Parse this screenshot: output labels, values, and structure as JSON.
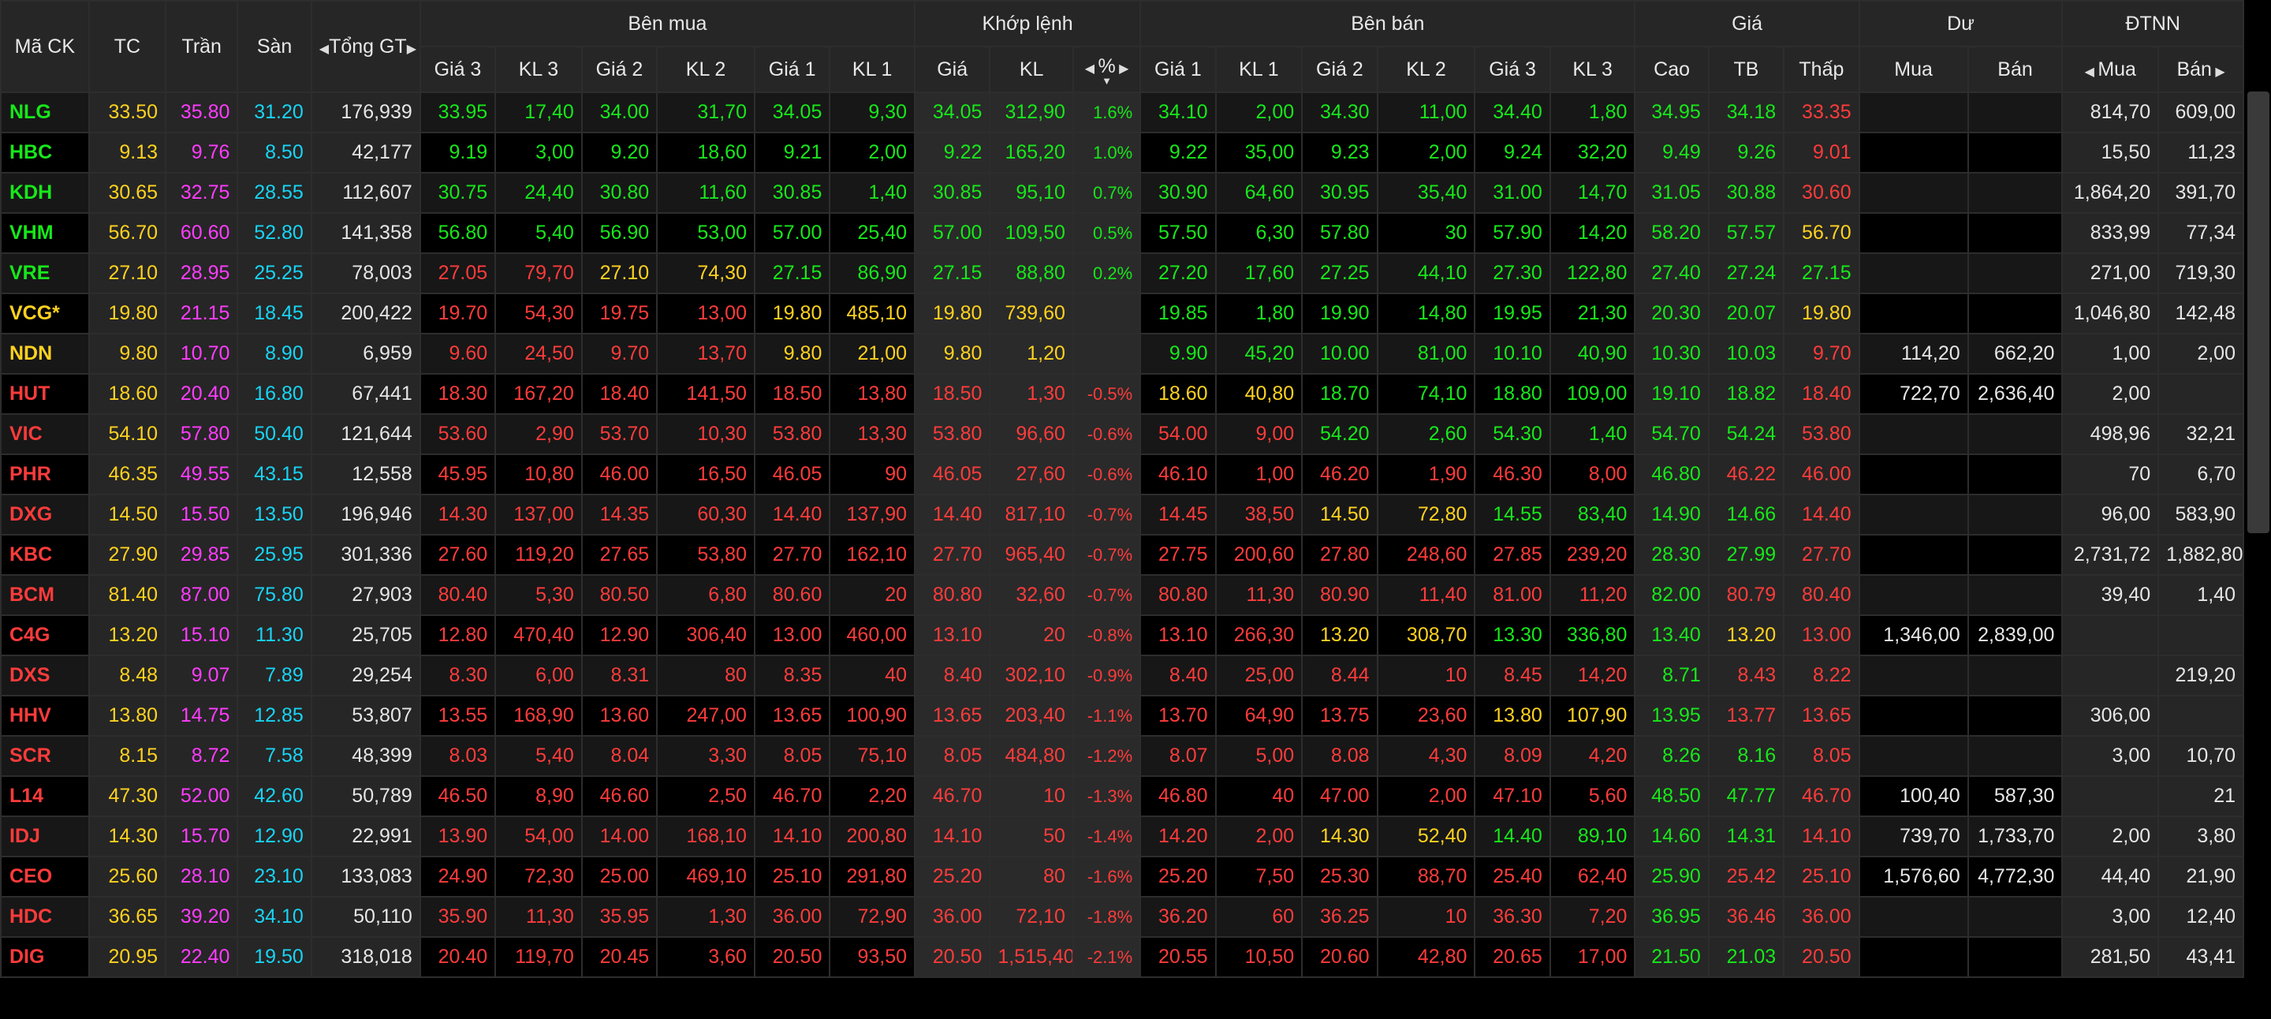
{
  "header": {
    "ma_ck": "Mã CK",
    "tc": "TC",
    "tran": "Trần",
    "san": "Sàn",
    "tong_gt": "Tổng GT",
    "ben_mua": "Bên mua",
    "khop_lenh": "Khớp lệnh",
    "ben_ban": "Bên bán",
    "gia": "Giá",
    "du": "Dư",
    "dtnn": "ĐTNN",
    "sub": {
      "gia3": "Giá 3",
      "kl3": "KL 3",
      "gia2": "Giá 2",
      "kl2": "KL 2",
      "gia1": "Giá 1",
      "kl1": "KL 1",
      "khop_gia": "Giá",
      "khop_kl": "KL",
      "pct": "%",
      "cao": "Cao",
      "tb": "TB",
      "thap": "Thấp",
      "du_mua": "Mua",
      "du_ban": "Bán",
      "dtnn_mua": "Mua",
      "dtnn_ban": "Bán"
    }
  },
  "colors": {
    "up": "#17e81a",
    "down": "#ff3b3b",
    "ref": "#ffd21f",
    "ceiling": "#ff3cff",
    "floor": "#18d4f4"
  },
  "rows": [
    {
      "sym": "NLG",
      "sc": "g",
      "tc": "33.50",
      "tran": "35.80",
      "san": "31.20",
      "tong": "176,939",
      "b3": [
        "33.95",
        "17,40",
        "g"
      ],
      "b2": [
        "34.00",
        "31,70",
        "g"
      ],
      "b1": [
        "34.05",
        "9,30",
        "g"
      ],
      "m": [
        "34.05",
        "312,90",
        "1.6%",
        "g"
      ],
      "s1": [
        "34.10",
        "2,00",
        "g"
      ],
      "s2": [
        "34.30",
        "11,00",
        "g"
      ],
      "s3": [
        "34.40",
        "1,80",
        "g"
      ],
      "cao": [
        "34.95",
        "g"
      ],
      "tb": [
        "34.18",
        "g"
      ],
      "thap": [
        "33.35",
        "r"
      ],
      "dm": "",
      "db": "",
      "nm": "814,70",
      "nb": "609,00"
    },
    {
      "sym": "HBC",
      "sc": "g",
      "tc": "9.13",
      "tran": "9.76",
      "san": "8.50",
      "tong": "42,177",
      "b3": [
        "9.19",
        "3,00",
        "g"
      ],
      "b2": [
        "9.20",
        "18,60",
        "g"
      ],
      "b1": [
        "9.21",
        "2,00",
        "g"
      ],
      "m": [
        "9.22",
        "165,20",
        "1.0%",
        "g"
      ],
      "s1": [
        "9.22",
        "35,00",
        "g"
      ],
      "s2": [
        "9.23",
        "2,00",
        "g"
      ],
      "s3": [
        "9.24",
        "32,20",
        "g"
      ],
      "cao": [
        "9.49",
        "g"
      ],
      "tb": [
        "9.26",
        "g"
      ],
      "thap": [
        "9.01",
        "r"
      ],
      "dm": "",
      "db": "",
      "nm": "15,50",
      "nb": "11,23"
    },
    {
      "sym": "KDH",
      "sc": "g",
      "tc": "30.65",
      "tran": "32.75",
      "san": "28.55",
      "tong": "112,607",
      "b3": [
        "30.75",
        "24,40",
        "g"
      ],
      "b2": [
        "30.80",
        "11,60",
        "g"
      ],
      "b1": [
        "30.85",
        "1,40",
        "g"
      ],
      "m": [
        "30.85",
        "95,10",
        "0.7%",
        "g"
      ],
      "s1": [
        "30.90",
        "64,60",
        "g"
      ],
      "s2": [
        "30.95",
        "35,40",
        "g"
      ],
      "s3": [
        "31.00",
        "14,70",
        "g"
      ],
      "cao": [
        "31.05",
        "g"
      ],
      "tb": [
        "30.88",
        "g"
      ],
      "thap": [
        "30.60",
        "r"
      ],
      "dm": "",
      "db": "",
      "nm": "1,864,20",
      "nb": "391,70"
    },
    {
      "sym": "VHM",
      "sc": "g",
      "tc": "56.70",
      "tran": "60.60",
      "san": "52.80",
      "tong": "141,358",
      "b3": [
        "56.80",
        "5,40",
        "g"
      ],
      "b2": [
        "56.90",
        "53,00",
        "g"
      ],
      "b1": [
        "57.00",
        "25,40",
        "g"
      ],
      "m": [
        "57.00",
        "109,50",
        "0.5%",
        "g"
      ],
      "s1": [
        "57.50",
        "6,30",
        "g"
      ],
      "s2": [
        "57.80",
        "30",
        "g"
      ],
      "s3": [
        "57.90",
        "14,20",
        "g"
      ],
      "cao": [
        "58.20",
        "g"
      ],
      "tb": [
        "57.57",
        "g"
      ],
      "thap": [
        "56.70",
        "y"
      ],
      "dm": "",
      "db": "",
      "nm": "833,99",
      "nb": "77,34"
    },
    {
      "sym": "VRE",
      "sc": "g",
      "tc": "27.10",
      "tran": "28.95",
      "san": "25.25",
      "tong": "78,003",
      "b3": [
        "27.05",
        "79,70",
        "r"
      ],
      "b2": [
        "27.10",
        "74,30",
        "y"
      ],
      "b1": [
        "27.15",
        "86,90",
        "g"
      ],
      "m": [
        "27.15",
        "88,80",
        "0.2%",
        "g"
      ],
      "s1": [
        "27.20",
        "17,60",
        "g"
      ],
      "s2": [
        "27.25",
        "44,10",
        "g"
      ],
      "s3": [
        "27.30",
        "122,80",
        "g"
      ],
      "cao": [
        "27.40",
        "g"
      ],
      "tb": [
        "27.24",
        "g"
      ],
      "thap": [
        "27.15",
        "g"
      ],
      "dm": "",
      "db": "",
      "nm": "271,00",
      "nb": "719,30"
    },
    {
      "sym": "VCG*",
      "sc": "y",
      "tc": "19.80",
      "tran": "21.15",
      "san": "18.45",
      "tong": "200,422",
      "b3": [
        "19.70",
        "54,30",
        "r"
      ],
      "b2": [
        "19.75",
        "13,00",
        "r"
      ],
      "b1": [
        "19.80",
        "485,10",
        "y"
      ],
      "m": [
        "19.80",
        "739,60",
        "",
        "y"
      ],
      "s1": [
        "19.85",
        "1,80",
        "g"
      ],
      "s2": [
        "19.90",
        "14,80",
        "g"
      ],
      "s3": [
        "19.95",
        "21,30",
        "g"
      ],
      "cao": [
        "20.30",
        "g"
      ],
      "tb": [
        "20.07",
        "g"
      ],
      "thap": [
        "19.80",
        "y"
      ],
      "dm": "",
      "db": "",
      "nm": "1,046,80",
      "nb": "142,48"
    },
    {
      "sym": "NDN",
      "sc": "y",
      "tc": "9.80",
      "tran": "10.70",
      "san": "8.90",
      "tong": "6,959",
      "b3": [
        "9.60",
        "24,50",
        "r"
      ],
      "b2": [
        "9.70",
        "13,70",
        "r"
      ],
      "b1": [
        "9.80",
        "21,00",
        "y"
      ],
      "m": [
        "9.80",
        "1,20",
        "",
        "y"
      ],
      "s1": [
        "9.90",
        "45,20",
        "g"
      ],
      "s2": [
        "10.00",
        "81,00",
        "g"
      ],
      "s3": [
        "10.10",
        "40,90",
        "g"
      ],
      "cao": [
        "10.30",
        "g"
      ],
      "tb": [
        "10.03",
        "g"
      ],
      "thap": [
        "9.70",
        "r"
      ],
      "dm": "114,20",
      "db": "662,20",
      "nm": "1,00",
      "nb": "2,00"
    },
    {
      "sym": "HUT",
      "sc": "r",
      "tc": "18.60",
      "tran": "20.40",
      "san": "16.80",
      "tong": "67,441",
      "b3": [
        "18.30",
        "167,20",
        "r"
      ],
      "b2": [
        "18.40",
        "141,50",
        "r"
      ],
      "b1": [
        "18.50",
        "13,80",
        "r"
      ],
      "m": [
        "18.50",
        "1,30",
        "-0.5%",
        "r"
      ],
      "s1": [
        "18.60",
        "40,80",
        "y"
      ],
      "s2": [
        "18.70",
        "74,10",
        "g"
      ],
      "s3": [
        "18.80",
        "109,00",
        "g"
      ],
      "cao": [
        "19.10",
        "g"
      ],
      "tb": [
        "18.82",
        "g"
      ],
      "thap": [
        "18.40",
        "r"
      ],
      "dm": "722,70",
      "db": "2,636,40",
      "nm": "2,00",
      "nb": ""
    },
    {
      "sym": "VIC",
      "sc": "r",
      "tc": "54.10",
      "tran": "57.80",
      "san": "50.40",
      "tong": "121,644",
      "b3": [
        "53.60",
        "2,90",
        "r"
      ],
      "b2": [
        "53.70",
        "10,30",
        "r"
      ],
      "b1": [
        "53.80",
        "13,30",
        "r"
      ],
      "m": [
        "53.80",
        "96,60",
        "-0.6%",
        "r"
      ],
      "s1": [
        "54.00",
        "9,00",
        "r"
      ],
      "s2": [
        "54.20",
        "2,60",
        "g"
      ],
      "s3": [
        "54.30",
        "1,40",
        "g"
      ],
      "cao": [
        "54.70",
        "g"
      ],
      "tb": [
        "54.24",
        "g"
      ],
      "thap": [
        "53.80",
        "r"
      ],
      "dm": "",
      "db": "",
      "nm": "498,96",
      "nb": "32,21"
    },
    {
      "sym": "PHR",
      "sc": "r",
      "tc": "46.35",
      "tran": "49.55",
      "san": "43.15",
      "tong": "12,558",
      "b3": [
        "45.95",
        "10,80",
        "r"
      ],
      "b2": [
        "46.00",
        "16,50",
        "r"
      ],
      "b1": [
        "46.05",
        "90",
        "r"
      ],
      "m": [
        "46.05",
        "27,60",
        "-0.6%",
        "r"
      ],
      "s1": [
        "46.10",
        "1,00",
        "r"
      ],
      "s2": [
        "46.20",
        "1,90",
        "r"
      ],
      "s3": [
        "46.30",
        "8,00",
        "r"
      ],
      "cao": [
        "46.80",
        "g"
      ],
      "tb": [
        "46.22",
        "r"
      ],
      "thap": [
        "46.00",
        "r"
      ],
      "dm": "",
      "db": "",
      "nm": "70",
      "nb": "6,70"
    },
    {
      "sym": "DXG",
      "sc": "r",
      "tc": "14.50",
      "tran": "15.50",
      "san": "13.50",
      "tong": "196,946",
      "b3": [
        "14.30",
        "137,00",
        "r"
      ],
      "b2": [
        "14.35",
        "60,30",
        "r"
      ],
      "b1": [
        "14.40",
        "137,90",
        "r"
      ],
      "m": [
        "14.40",
        "817,10",
        "-0.7%",
        "r"
      ],
      "s1": [
        "14.45",
        "38,50",
        "r"
      ],
      "s2": [
        "14.50",
        "72,80",
        "y"
      ],
      "s3": [
        "14.55",
        "83,40",
        "g"
      ],
      "cao": [
        "14.90",
        "g"
      ],
      "tb": [
        "14.66",
        "g"
      ],
      "thap": [
        "14.40",
        "r"
      ],
      "dm": "",
      "db": "",
      "nm": "96,00",
      "nb": "583,90"
    },
    {
      "sym": "KBC",
      "sc": "r",
      "tc": "27.90",
      "tran": "29.85",
      "san": "25.95",
      "tong": "301,336",
      "b3": [
        "27.60",
        "119,20",
        "r"
      ],
      "b2": [
        "27.65",
        "53,80",
        "r"
      ],
      "b1": [
        "27.70",
        "162,10",
        "r"
      ],
      "m": [
        "27.70",
        "965,40",
        "-0.7%",
        "r"
      ],
      "s1": [
        "27.75",
        "200,60",
        "r"
      ],
      "s2": [
        "27.80",
        "248,60",
        "r"
      ],
      "s3": [
        "27.85",
        "239,20",
        "r"
      ],
      "cao": [
        "28.30",
        "g"
      ],
      "tb": [
        "27.99",
        "g"
      ],
      "thap": [
        "27.70",
        "r"
      ],
      "dm": "",
      "db": "",
      "nm": "2,731,72",
      "nb": "1,882,80"
    },
    {
      "sym": "BCM",
      "sc": "r",
      "tc": "81.40",
      "tran": "87.00",
      "san": "75.80",
      "tong": "27,903",
      "b3": [
        "80.40",
        "5,30",
        "r"
      ],
      "b2": [
        "80.50",
        "6,80",
        "r"
      ],
      "b1": [
        "80.60",
        "20",
        "r"
      ],
      "m": [
        "80.80",
        "32,60",
        "-0.7%",
        "r"
      ],
      "s1": [
        "80.80",
        "11,30",
        "r"
      ],
      "s2": [
        "80.90",
        "11,40",
        "r"
      ],
      "s3": [
        "81.00",
        "11,20",
        "r"
      ],
      "cao": [
        "82.00",
        "g"
      ],
      "tb": [
        "80.79",
        "r"
      ],
      "thap": [
        "80.40",
        "r"
      ],
      "dm": "",
      "db": "",
      "nm": "39,40",
      "nb": "1,40"
    },
    {
      "sym": "C4G",
      "sc": "r",
      "tc": "13.20",
      "tran": "15.10",
      "san": "11.30",
      "tong": "25,705",
      "b3": [
        "12.80",
        "470,40",
        "r"
      ],
      "b2": [
        "12.90",
        "306,40",
        "r"
      ],
      "b1": [
        "13.00",
        "460,00",
        "r"
      ],
      "m": [
        "13.10",
        "20",
        "-0.8%",
        "r"
      ],
      "s1": [
        "13.10",
        "266,30",
        "r"
      ],
      "s2": [
        "13.20",
        "308,70",
        "y"
      ],
      "s3": [
        "13.30",
        "336,80",
        "g"
      ],
      "cao": [
        "13.40",
        "g"
      ],
      "tb": [
        "13.20",
        "y"
      ],
      "thap": [
        "13.00",
        "r"
      ],
      "dm": "1,346,00",
      "db": "2,839,00",
      "nm": "",
      "nb": ""
    },
    {
      "sym": "DXS",
      "sc": "r",
      "tc": "8.48",
      "tran": "9.07",
      "san": "7.89",
      "tong": "29,254",
      "b3": [
        "8.30",
        "6,00",
        "r"
      ],
      "b2": [
        "8.31",
        "80",
        "r"
      ],
      "b1": [
        "8.35",
        "40",
        "r"
      ],
      "m": [
        "8.40",
        "302,10",
        "-0.9%",
        "r"
      ],
      "s1": [
        "8.40",
        "25,00",
        "r"
      ],
      "s2": [
        "8.44",
        "10",
        "r"
      ],
      "s3": [
        "8.45",
        "14,20",
        "r"
      ],
      "cao": [
        "8.71",
        "g"
      ],
      "tb": [
        "8.43",
        "r"
      ],
      "thap": [
        "8.22",
        "r"
      ],
      "dm": "",
      "db": "",
      "nm": "",
      "nb": "219,20"
    },
    {
      "sym": "HHV",
      "sc": "r",
      "tc": "13.80",
      "tran": "14.75",
      "san": "12.85",
      "tong": "53,807",
      "b3": [
        "13.55",
        "168,90",
        "r"
      ],
      "b2": [
        "13.60",
        "247,00",
        "r"
      ],
      "b1": [
        "13.65",
        "100,90",
        "r"
      ],
      "m": [
        "13.65",
        "203,40",
        "-1.1%",
        "r"
      ],
      "s1": [
        "13.70",
        "64,90",
        "r"
      ],
      "s2": [
        "13.75",
        "23,60",
        "r"
      ],
      "s3": [
        "13.80",
        "107,90",
        "y"
      ],
      "cao": [
        "13.95",
        "g"
      ],
      "tb": [
        "13.77",
        "r"
      ],
      "thap": [
        "13.65",
        "r"
      ],
      "dm": "",
      "db": "",
      "nm": "306,00",
      "nb": ""
    },
    {
      "sym": "SCR",
      "sc": "r",
      "tc": "8.15",
      "tran": "8.72",
      "san": "7.58",
      "tong": "48,399",
      "b3": [
        "8.03",
        "5,40",
        "r"
      ],
      "b2": [
        "8.04",
        "3,30",
        "r"
      ],
      "b1": [
        "8.05",
        "75,10",
        "r"
      ],
      "m": [
        "8.05",
        "484,80",
        "-1.2%",
        "r"
      ],
      "s1": [
        "8.07",
        "5,00",
        "r"
      ],
      "s2": [
        "8.08",
        "4,30",
        "r"
      ],
      "s3": [
        "8.09",
        "4,20",
        "r"
      ],
      "cao": [
        "8.26",
        "g"
      ],
      "tb": [
        "8.16",
        "g"
      ],
      "thap": [
        "8.05",
        "r"
      ],
      "dm": "",
      "db": "",
      "nm": "3,00",
      "nb": "10,70"
    },
    {
      "sym": "L14",
      "sc": "r",
      "tc": "47.30",
      "tran": "52.00",
      "san": "42.60",
      "tong": "50,789",
      "b3": [
        "46.50",
        "8,90",
        "r"
      ],
      "b2": [
        "46.60",
        "2,50",
        "r"
      ],
      "b1": [
        "46.70",
        "2,20",
        "r"
      ],
      "m": [
        "46.70",
        "10",
        "-1.3%",
        "r"
      ],
      "s1": [
        "46.80",
        "40",
        "r"
      ],
      "s2": [
        "47.00",
        "2,00",
        "r"
      ],
      "s3": [
        "47.10",
        "5,60",
        "r"
      ],
      "cao": [
        "48.50",
        "g"
      ],
      "tb": [
        "47.77",
        "g"
      ],
      "thap": [
        "46.70",
        "r"
      ],
      "dm": "100,40",
      "db": "587,30",
      "nm": "",
      "nb": "21"
    },
    {
      "sym": "IDJ",
      "sc": "r",
      "tc": "14.30",
      "tran": "15.70",
      "san": "12.90",
      "tong": "22,991",
      "b3": [
        "13.90",
        "54,00",
        "r"
      ],
      "b2": [
        "14.00",
        "168,10",
        "r"
      ],
      "b1": [
        "14.10",
        "200,80",
        "r"
      ],
      "m": [
        "14.10",
        "50",
        "-1.4%",
        "r"
      ],
      "s1": [
        "14.20",
        "2,00",
        "r"
      ],
      "s2": [
        "14.30",
        "52,40",
        "y"
      ],
      "s3": [
        "14.40",
        "89,10",
        "g"
      ],
      "cao": [
        "14.60",
        "g"
      ],
      "tb": [
        "14.31",
        "g"
      ],
      "thap": [
        "14.10",
        "r"
      ],
      "dm": "739,70",
      "db": "1,733,70",
      "nm": "2,00",
      "nb": "3,80"
    },
    {
      "sym": "CEO",
      "sc": "r",
      "tc": "25.60",
      "tran": "28.10",
      "san": "23.10",
      "tong": "133,083",
      "b3": [
        "24.90",
        "72,30",
        "r"
      ],
      "b2": [
        "25.00",
        "469,10",
        "r"
      ],
      "b1": [
        "25.10",
        "291,80",
        "r"
      ],
      "m": [
        "25.20",
        "80",
        "-1.6%",
        "r"
      ],
      "s1": [
        "25.20",
        "7,50",
        "r"
      ],
      "s2": [
        "25.30",
        "88,70",
        "r"
      ],
      "s3": [
        "25.40",
        "62,40",
        "r"
      ],
      "cao": [
        "25.90",
        "g"
      ],
      "tb": [
        "25.42",
        "r"
      ],
      "thap": [
        "25.10",
        "r"
      ],
      "dm": "1,576,60",
      "db": "4,772,30",
      "nm": "44,40",
      "nb": "21,90"
    },
    {
      "sym": "HDC",
      "sc": "r",
      "tc": "36.65",
      "tran": "39.20",
      "san": "34.10",
      "tong": "50,110",
      "b3": [
        "35.90",
        "11,30",
        "r"
      ],
      "b2": [
        "35.95",
        "1,30",
        "r"
      ],
      "b1": [
        "36.00",
        "72,90",
        "r"
      ],
      "m": [
        "36.00",
        "72,10",
        "-1.8%",
        "r"
      ],
      "s1": [
        "36.20",
        "60",
        "r"
      ],
      "s2": [
        "36.25",
        "10",
        "r"
      ],
      "s3": [
        "36.30",
        "7,20",
        "r"
      ],
      "cao": [
        "36.95",
        "g"
      ],
      "tb": [
        "36.46",
        "r"
      ],
      "thap": [
        "36.00",
        "r"
      ],
      "dm": "",
      "db": "",
      "nm": "3,00",
      "nb": "12,40"
    },
    {
      "sym": "DIG",
      "sc": "r",
      "tc": "20.95",
      "tran": "22.40",
      "san": "19.50",
      "tong": "318,018",
      "b3": [
        "20.40",
        "119,70",
        "r"
      ],
      "b2": [
        "20.45",
        "3,60",
        "r"
      ],
      "b1": [
        "20.50",
        "93,50",
        "r"
      ],
      "m": [
        "20.50",
        "1,515,40",
        "-2.1%",
        "r"
      ],
      "s1": [
        "20.55",
        "10,50",
        "r"
      ],
      "s2": [
        "20.60",
        "42,80",
        "r"
      ],
      "s3": [
        "20.65",
        "17,00",
        "r"
      ],
      "cao": [
        "21.50",
        "g"
      ],
      "tb": [
        "21.03",
        "g"
      ],
      "thap": [
        "20.50",
        "r"
      ],
      "dm": "",
      "db": "",
      "nm": "281,50",
      "nb": "43,41"
    }
  ]
}
